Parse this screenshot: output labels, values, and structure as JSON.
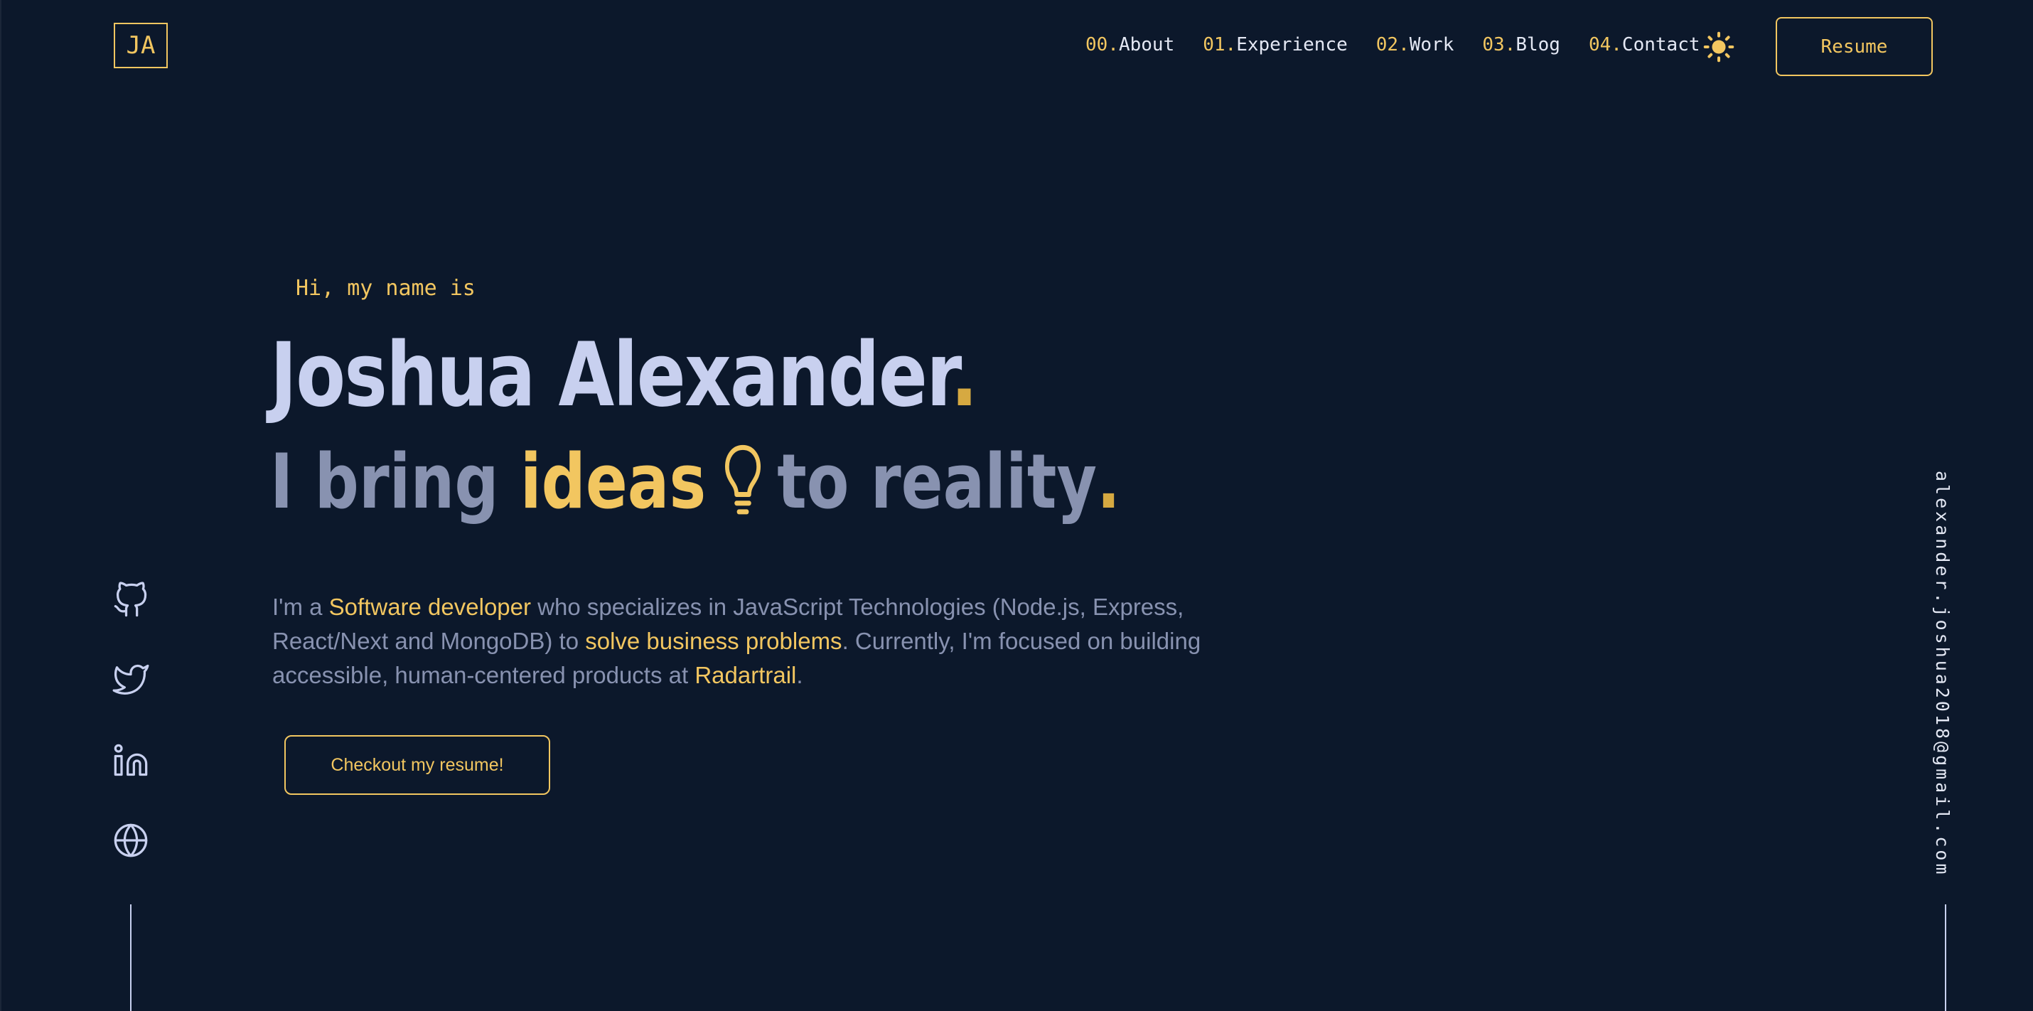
{
  "logo": {
    "text": "JA"
  },
  "nav": {
    "items": [
      {
        "num": "00.",
        "label": "About"
      },
      {
        "num": "01.",
        "label": "Experience"
      },
      {
        "num": "02.",
        "label": "Work"
      },
      {
        "num": "03.",
        "label": "Blog"
      },
      {
        "num": "04.",
        "label": "Contact"
      }
    ],
    "theme_icon": "sun-icon",
    "resume_label": "Resume"
  },
  "hero": {
    "greeting": "Hi, my name is",
    "name": "Joshua Alexander",
    "name_dot": ".",
    "tagline": {
      "part1": "I bring",
      "highlight": "ideas",
      "icon": "lightbulb-icon",
      "part2": "to reality",
      "dot": "."
    },
    "bio": {
      "t1": "I'm a ",
      "h1": "Software developer",
      "t2": " who specializes in JavaScript Technologies (Node.js, Express, React/Next and MongoDB) to ",
      "h2": "solve business problems",
      "t3": ". Currently, I'm focused on building accessible, human-centered products at ",
      "h3": "Radartrail",
      "t4": "."
    },
    "cta_label": "Checkout my resume!"
  },
  "social": [
    "github-icon",
    "twitter-icon",
    "linkedin-icon",
    "globe-icon"
  ],
  "email": "alexander.joshua2018@gmail.com",
  "colors": {
    "background": "#0c182b",
    "accent": "#f2c660",
    "heading": "#c8d0ef",
    "muted": "#8892b0",
    "text": "#e4e8f4"
  }
}
